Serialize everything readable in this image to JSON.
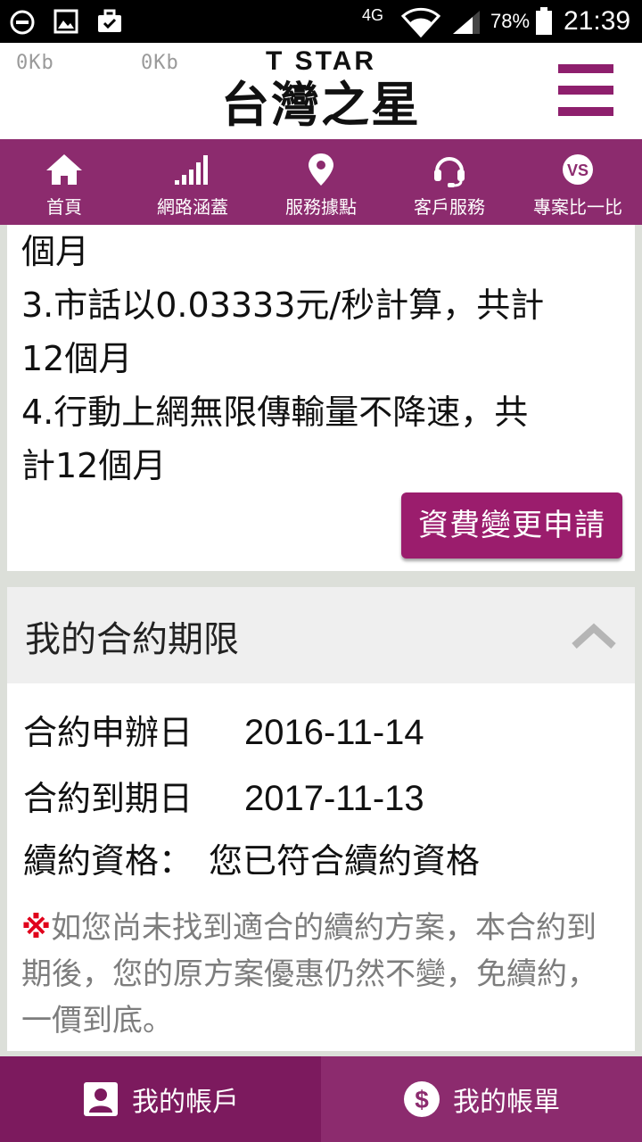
{
  "status_bar": {
    "network": "4G",
    "battery": "78%",
    "time": "21:39"
  },
  "header": {
    "speed_left": "0Kb",
    "speed_right": "0Kb",
    "logo_en": "T STAR",
    "logo_zh": "台灣之星"
  },
  "nav": {
    "items": [
      {
        "label": "首頁",
        "icon": "home-icon"
      },
      {
        "label": "網路涵蓋",
        "icon": "signal-bars-icon"
      },
      {
        "label": "服務據點",
        "icon": "location-pin-icon"
      },
      {
        "label": "客戶服務",
        "icon": "headset-icon"
      },
      {
        "label": "專案比一比",
        "icon": "vs-icon"
      }
    ]
  },
  "plan": {
    "lines": [
      "個月",
      "3.市話以0.03333元/秒計算，共計",
      "12個月",
      "4.行動上網無限傳輸量不降速，共",
      "計12個月"
    ],
    "change_button": "資費變更申請"
  },
  "contract": {
    "title": "我的合約期限",
    "start_label": "合約申辦日",
    "start_value": "2016-11-14",
    "end_label": "合約到期日",
    "end_value": "2017-11-13",
    "renew_label": "續約資格：",
    "renew_value": "您已符合續約資格",
    "notice_mark": "※",
    "notice_text": "如您尚未找到適合的續約方案，本合約到期後，您的原方案優惠仍然不變，免續約，一價到底。"
  },
  "bottom_tabs": {
    "account": "我的帳戶",
    "bill": "我的帳單"
  },
  "colors": {
    "brand": "#8c2b6e",
    "brand_dark": "#7c1a5e",
    "button": "#9b1d6d",
    "notice_mark": "#e0001b"
  }
}
